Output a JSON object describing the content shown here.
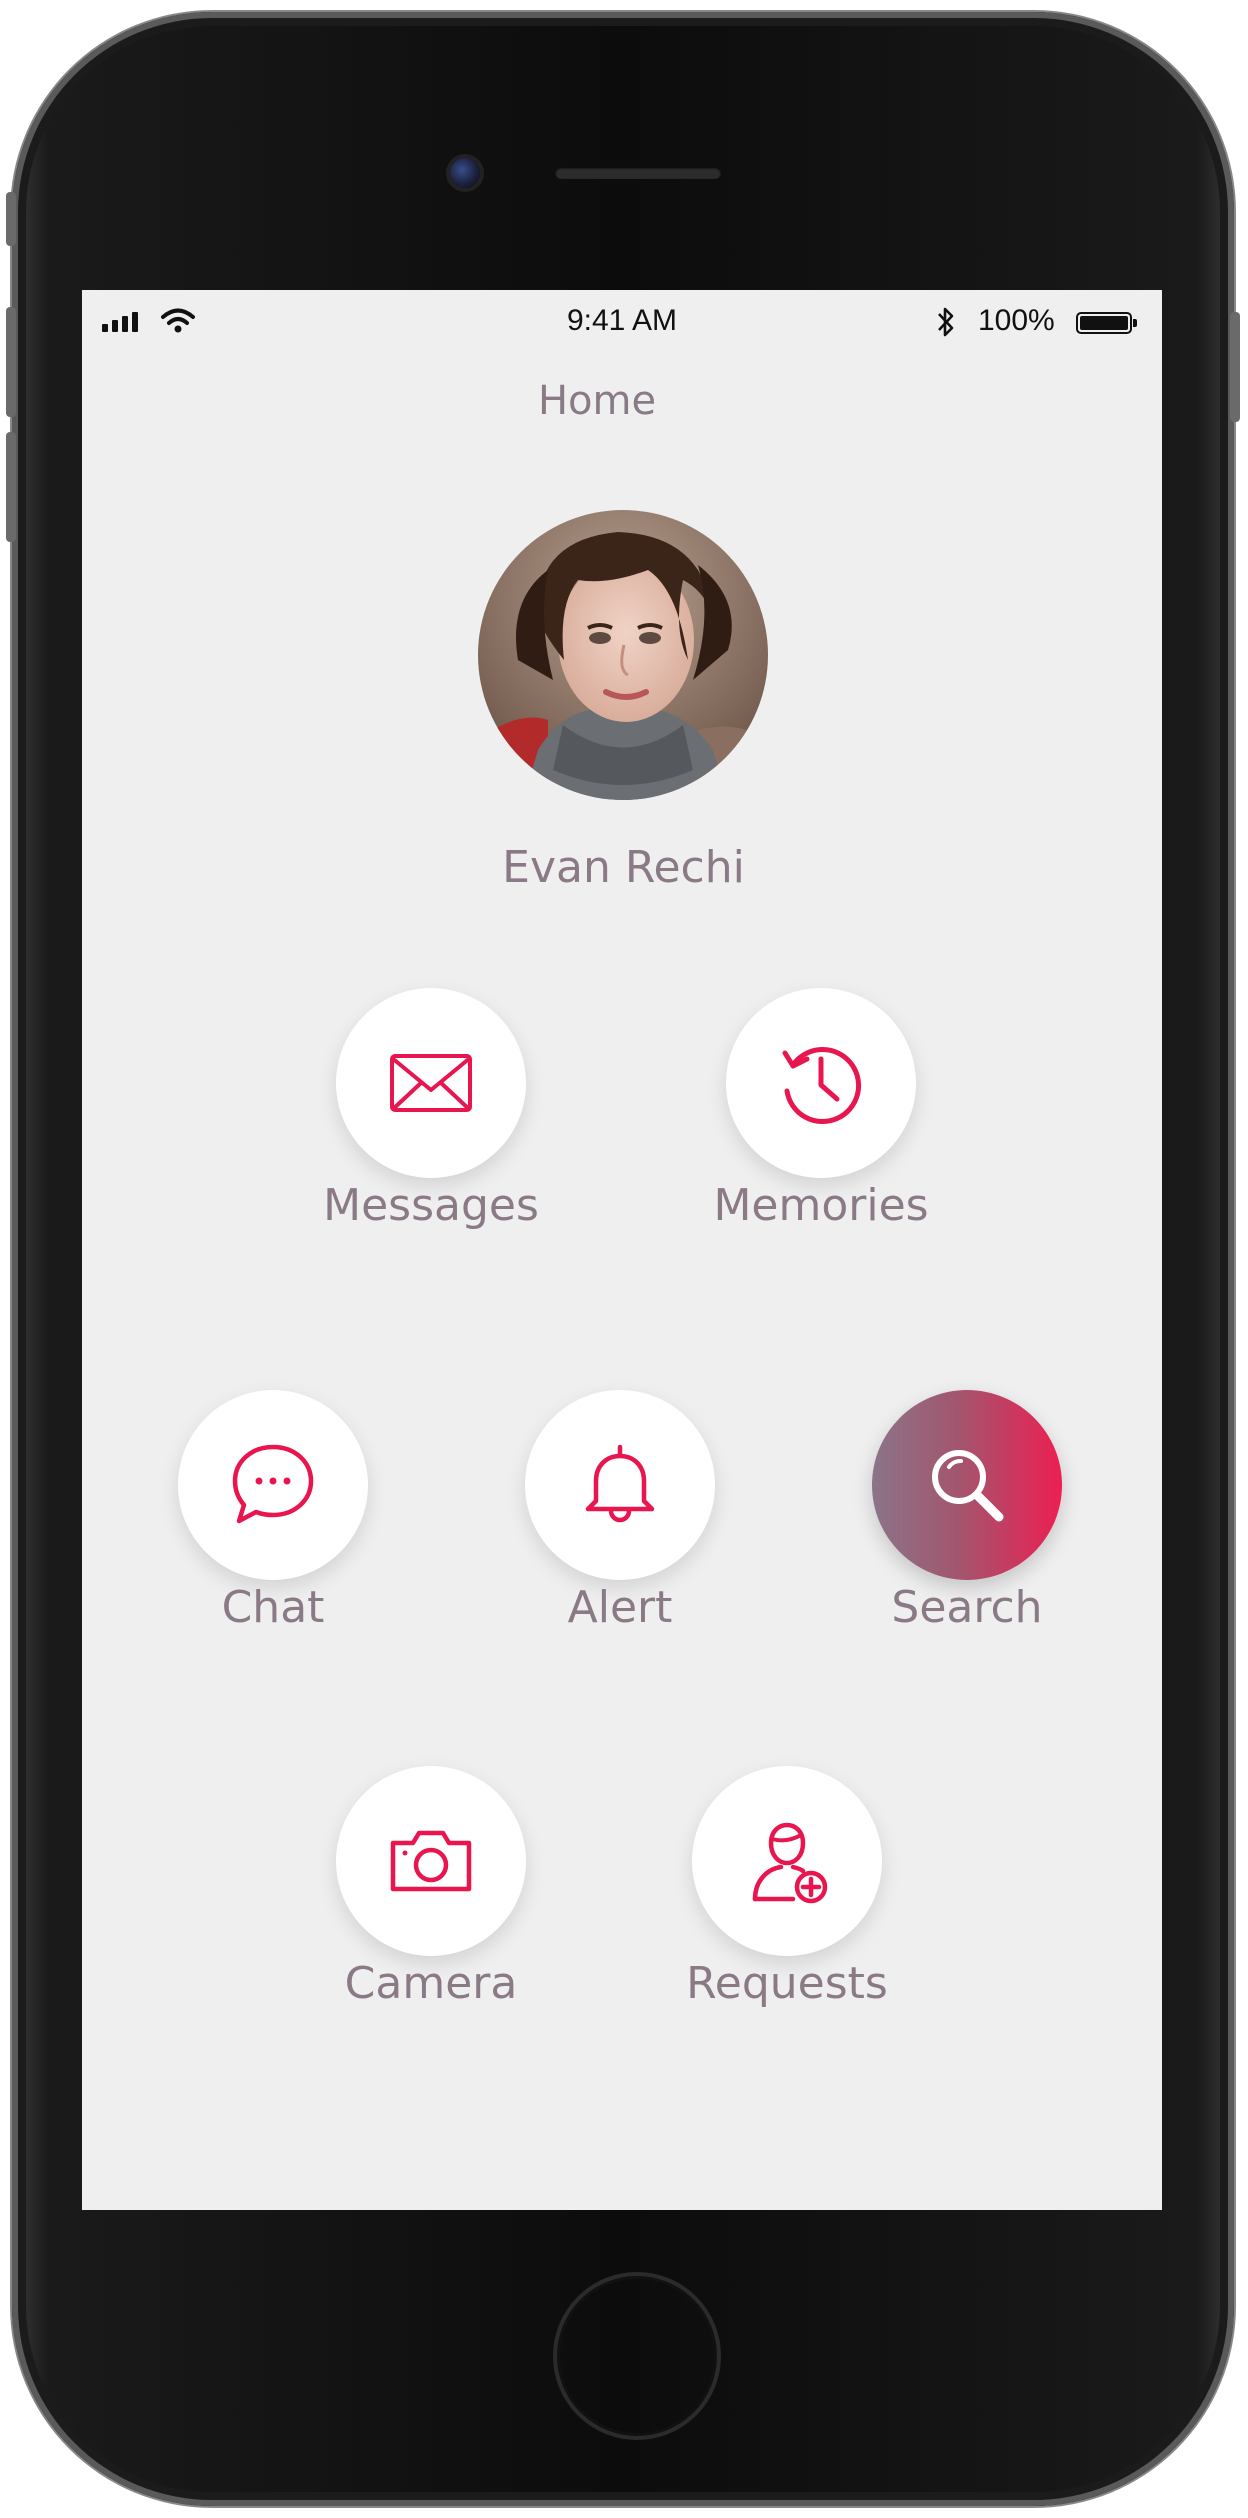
{
  "status_bar": {
    "time": "9:41 AM",
    "battery": "100%"
  },
  "header": {
    "title": "Home"
  },
  "profile": {
    "name": "Evan Rechi"
  },
  "menu": {
    "messages": {
      "label": "Messages",
      "icon": "envelope-icon"
    },
    "memories": {
      "label": "Memories",
      "icon": "history-icon"
    },
    "chat": {
      "label": "Chat",
      "icon": "chat-bubble-icon"
    },
    "alert": {
      "label": "Alert",
      "icon": "bell-icon"
    },
    "search": {
      "label": "Search",
      "icon": "search-icon",
      "selected": true
    },
    "camera": {
      "label": "Camera",
      "icon": "camera-icon"
    },
    "requests": {
      "label": "Requests",
      "icon": "add-user-icon"
    }
  },
  "colors": {
    "accent": "#e8154e",
    "label": "#8a7a86",
    "background": "#f0eff0",
    "active_gradient_start": "#8b7488",
    "active_gradient_end": "#ec1f52"
  }
}
